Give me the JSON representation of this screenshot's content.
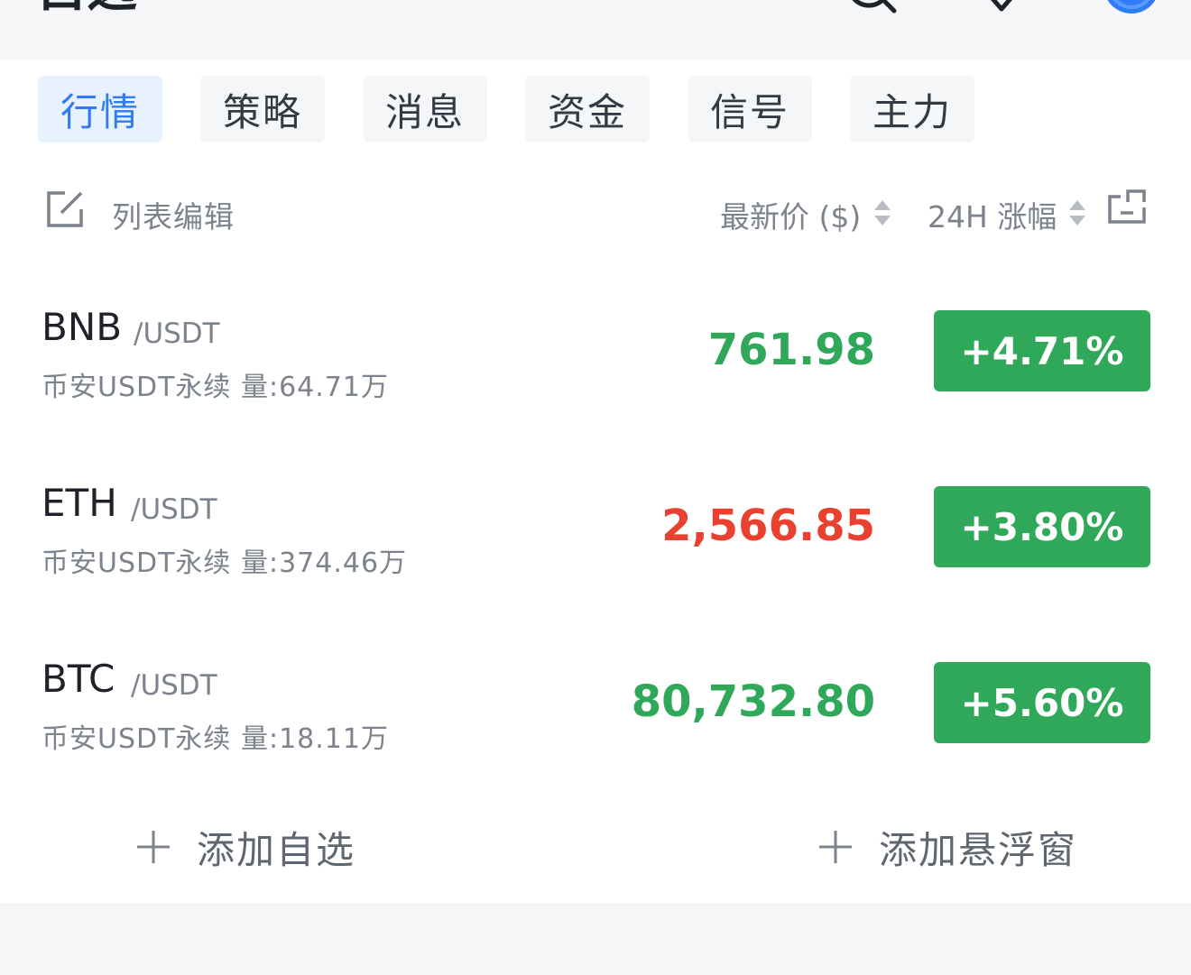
{
  "header": {
    "title": "自选"
  },
  "tabs": [
    {
      "label": "行情",
      "active": true
    },
    {
      "label": "策略",
      "active": false
    },
    {
      "label": "消息",
      "active": false
    },
    {
      "label": "资金",
      "active": false
    },
    {
      "label": "信号",
      "active": false
    },
    {
      "label": "主力",
      "active": false
    }
  ],
  "list_header": {
    "edit_label": "列表编辑",
    "price_col": "最新价 ($)",
    "change_col": "24H 涨幅"
  },
  "rows": [
    {
      "symbol": "BNB",
      "quote": "/USDT",
      "sub": "币安USDT永续  量:64.71万",
      "price": "761.98",
      "price_color": "#2fa85a",
      "change": "+4.71%"
    },
    {
      "symbol": "ETH",
      "quote": "/USDT",
      "sub": "币安USDT永续  量:374.46万",
      "price": "2,566.85",
      "price_color": "#e8412f",
      "change": "+3.80%"
    },
    {
      "symbol": "BTC",
      "quote": "/USDT",
      "sub": "币安USDT永续  量:18.11万",
      "price": "80,732.80",
      "price_color": "#2fa85a",
      "change": "+5.60%"
    }
  ],
  "actions": {
    "add_watchlist": "添加自选",
    "add_float": "添加悬浮窗"
  },
  "colors": {
    "accent": "#2f7cf6",
    "up_green": "#2fa85a",
    "down_red": "#e8412f"
  }
}
